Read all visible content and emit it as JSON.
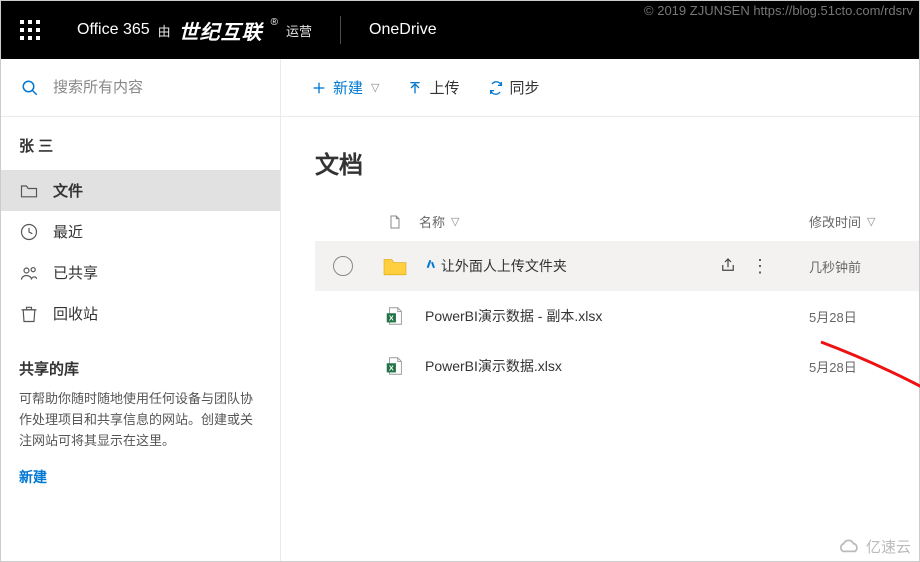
{
  "watermark": "© 2019 ZJUNSEN https://blog.51cto.com/rdsrv",
  "header": {
    "office": "Office 365",
    "by": "由",
    "cn_brand": "世纪互联",
    "operated": "运营",
    "app": "OneDrive"
  },
  "search": {
    "placeholder": "搜索所有内容"
  },
  "commands": {
    "new": "新建",
    "upload": "上传",
    "sync": "同步"
  },
  "sidebar": {
    "user": "张 三",
    "items": [
      {
        "label": "文件"
      },
      {
        "label": "最近"
      },
      {
        "label": "已共享"
      },
      {
        "label": "回收站"
      }
    ],
    "lib_title": "共享的库",
    "lib_desc": "可帮助你随时随地使用任何设备与团队协作处理项目和共享信息的网站。创建或关注网站可将其显示在这里。",
    "lib_new": "新建"
  },
  "main": {
    "title": "文档",
    "columns": {
      "name": "名称",
      "modified": "修改时间"
    },
    "rows": [
      {
        "name": "让外面人上传文件夹",
        "modified": "几秒钟前",
        "type": "folder",
        "selected": true,
        "fresh": true
      },
      {
        "name": "PowerBI演示数据 - 副本.xlsx",
        "modified": "5月28日",
        "type": "xlsx",
        "selected": false
      },
      {
        "name": "PowerBI演示数据.xlsx",
        "modified": "5月28日",
        "type": "xlsx",
        "selected": false
      }
    ]
  },
  "tooltip": "共享",
  "footer_brand": "亿速云"
}
